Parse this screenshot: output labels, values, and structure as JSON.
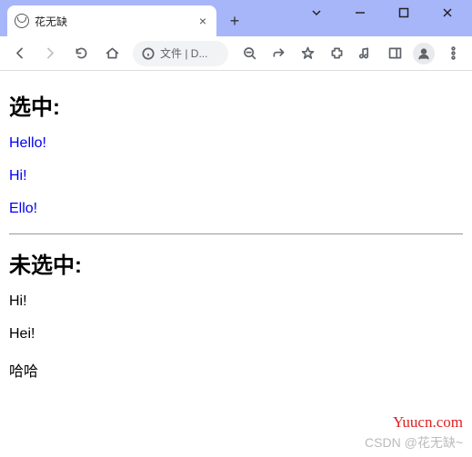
{
  "tab": {
    "title": "花无缺"
  },
  "address": {
    "text": "文件 | D..."
  },
  "content": {
    "selected": {
      "heading": "选中:",
      "items": [
        "Hello!",
        "Hi!",
        "Ello!"
      ]
    },
    "unselected": {
      "heading": "未选中:",
      "items": [
        "Hi!",
        "Hei!",
        "哈哈"
      ]
    }
  },
  "watermark": {
    "site": "Yuucn.com",
    "author": "CSDN @花无缺~"
  }
}
